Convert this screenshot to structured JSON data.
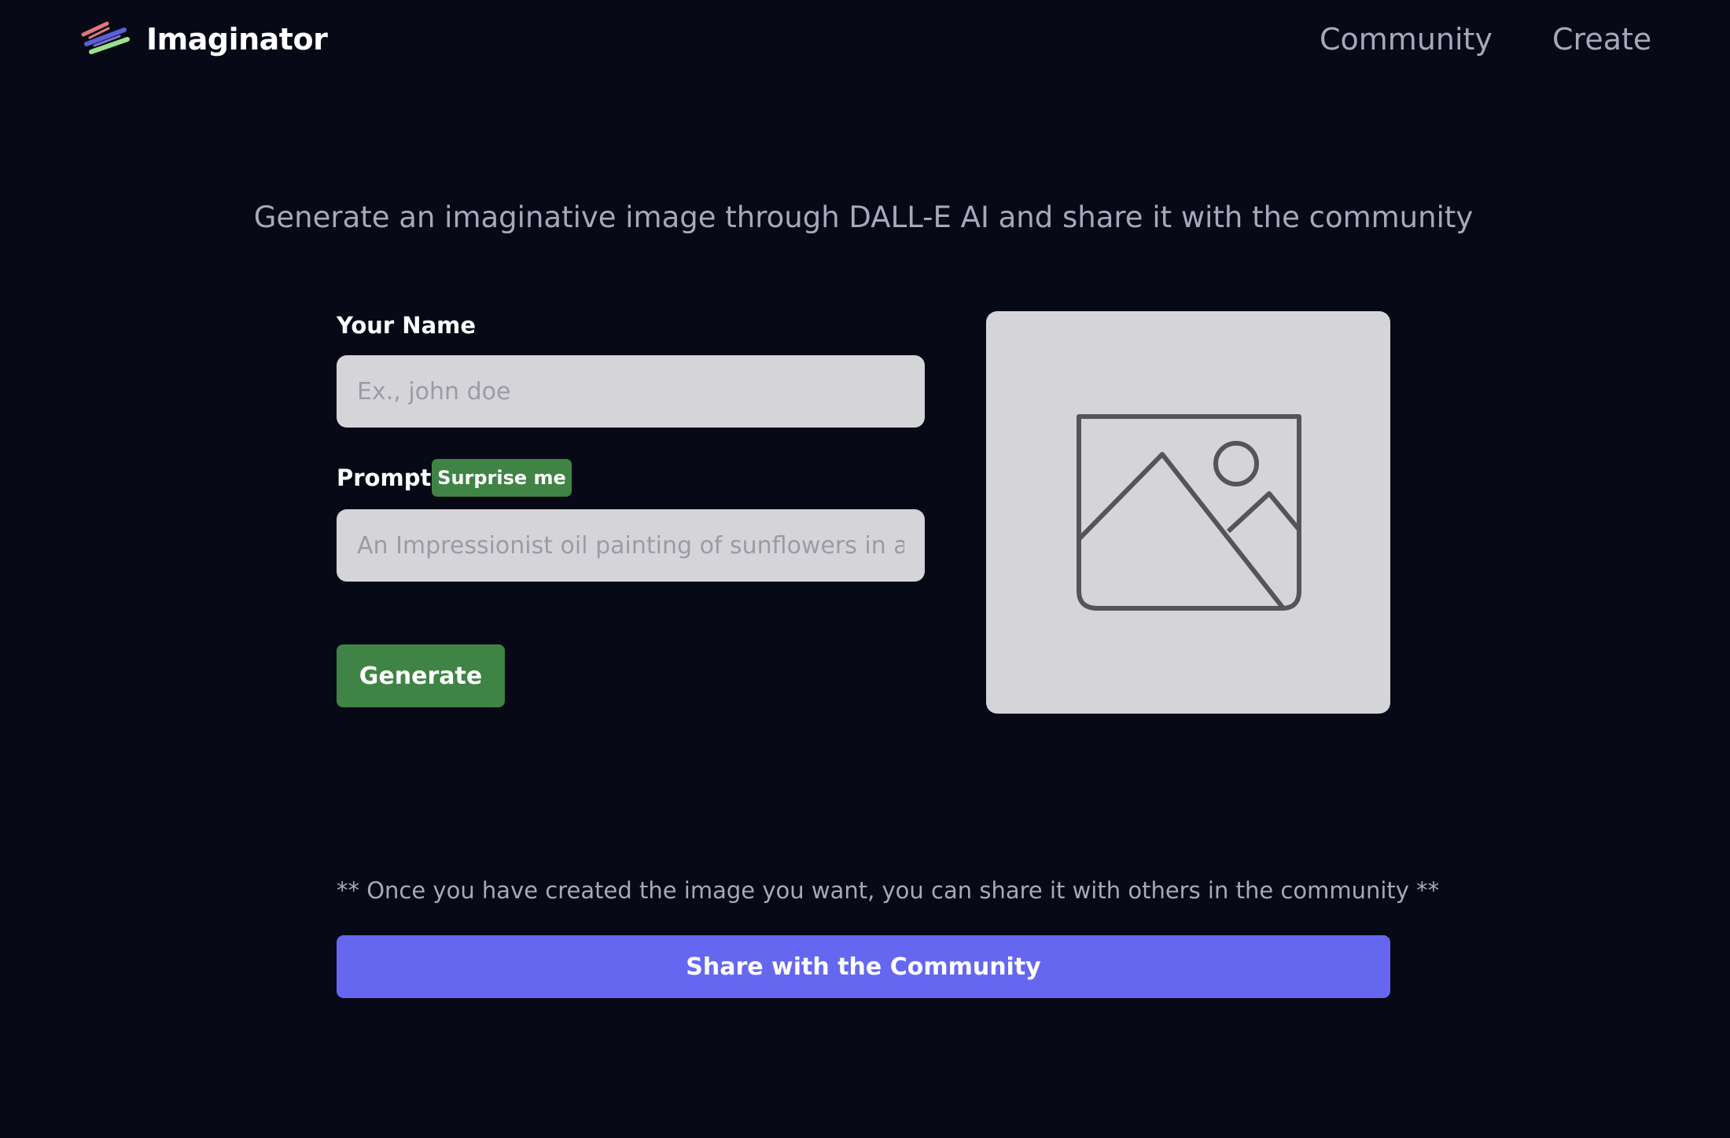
{
  "app": {
    "name": "Imaginator",
    "logo_icon": "paint-strokes-icon"
  },
  "nav": {
    "community": "Community",
    "create": "Create"
  },
  "tagline": "Generate an imaginative image through DALL-E AI and share it with the community",
  "form": {
    "name_label": "Your Name",
    "name_value": "",
    "name_placeholder": "Ex., john doe",
    "prompt_label": "Prompt",
    "surprise_label": "Surprise me",
    "prompt_value": "",
    "prompt_placeholder": "An Impressionist oil painting of sunflowers in a purple vase...",
    "generate_label": "Generate"
  },
  "preview": {
    "icon": "image-placeholder-icon"
  },
  "share": {
    "note": "** Once you have created the image you want, you can share it with others in the community **",
    "button_label": "Share with the Community"
  },
  "colors": {
    "background": "#070916",
    "accent_green": "#3f8444",
    "accent_purple": "#6567f1",
    "muted_text": "#a7a8bb",
    "field_bg": "#d5d5d9"
  }
}
